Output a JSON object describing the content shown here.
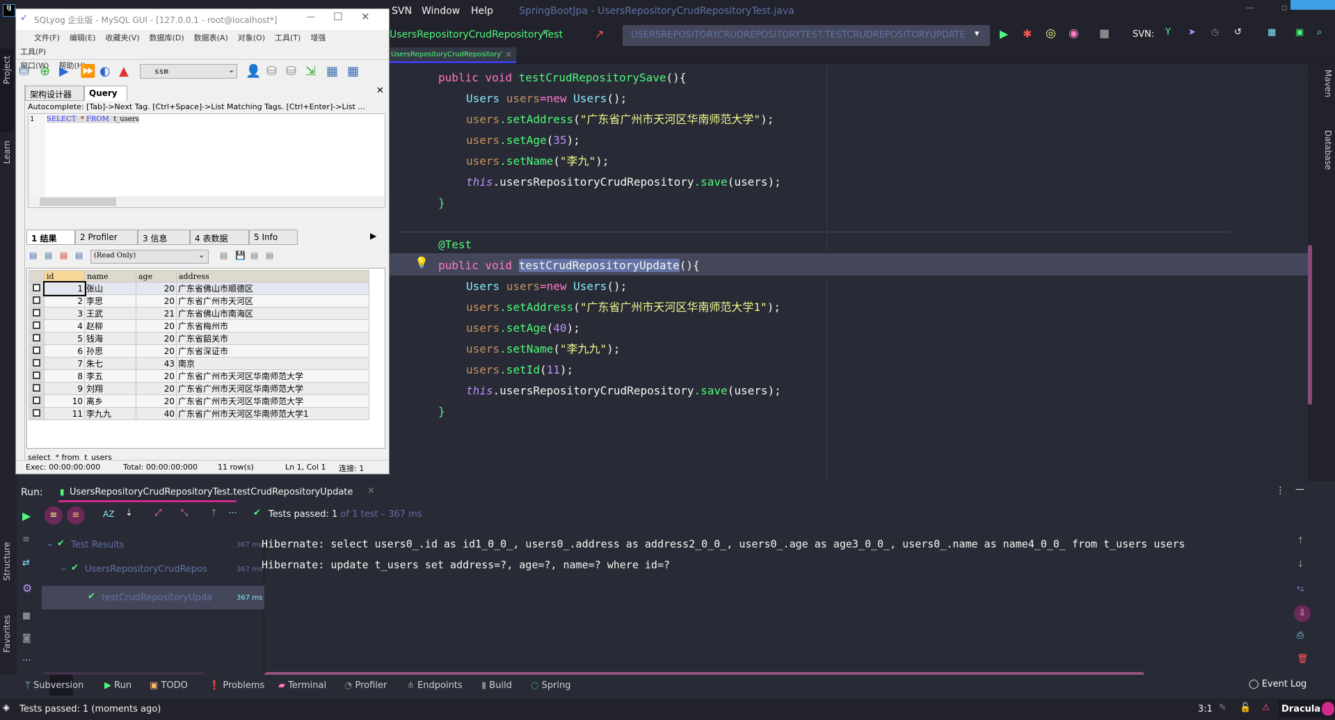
{
  "ide": {
    "menu": [
      "SVN",
      "Window",
      "Help"
    ],
    "title": "SpringBootJpa - UsersRepositoryCrudRepositoryTest.java",
    "breadcrumb": "UsersRepositoryCrudRepositoryTest",
    "run_config": "USERSREPOSITORYCRUDREPOSITORYTEST.TESTCRUDREPOSITORYUPDATE",
    "svn_label": "SVN:",
    "file_tab": "UsersRepositoryCrudRepositoryTest.java",
    "left_tools": [
      "Project",
      "Learn",
      "Structure",
      "Favorites"
    ],
    "right_tools": [
      "Maven",
      "Database"
    ],
    "accent": "#ff79c6"
  },
  "code": {
    "save_method": {
      "signature": [
        "public void ",
        "testCrudRepositorySave",
        "(){"
      ],
      "lines": [
        [
          "Users ",
          "users",
          "=new ",
          "Users",
          "();"
        ],
        [
          "users",
          ".setAddress",
          "(",
          "\"广东省广州市天河区华南师范大学\"",
          ");"
        ],
        [
          "users",
          ".setAge",
          "(",
          "35",
          ");"
        ],
        [
          "users",
          ".setName",
          "(",
          "\"李九\"",
          ");"
        ],
        [
          "this",
          ".usersRepositoryCrudRepository",
          ".save",
          "(users);"
        ]
      ],
      "close": "}"
    },
    "annotation": "@Test",
    "update_method": {
      "signature": [
        "public void ",
        "testCrudRepositoryUpdate",
        "(){"
      ],
      "lines": [
        [
          "Users ",
          "users",
          "=new ",
          "Users",
          "();"
        ],
        [
          "users",
          ".setAddress",
          "(",
          "\"广东省广州市天河区华南师范大学1\"",
          ");"
        ],
        [
          "users",
          ".setAge",
          "(",
          "40",
          ");"
        ],
        [
          "users",
          ".setName",
          "(",
          "\"李九九\"",
          ");"
        ],
        [
          "users",
          ".setId",
          "(",
          "11",
          ");"
        ],
        [
          "this",
          ".usersRepositoryCrudRepository",
          ".save",
          "(users);"
        ]
      ],
      "close": "}"
    }
  },
  "sqlyog": {
    "title": "SQLyog 企业版 - MySQL GUI - [127.0.0.1 - root@localhost*]",
    "menu": [
      "文件(F)",
      "编辑(E)",
      "收藏夹(V)",
      "数据库(D)",
      "数据表(A)",
      "对象(O)",
      "工具(T)",
      "增强工具(P)",
      "窗口(W)",
      "帮助(H)"
    ],
    "database": "ssm",
    "tabs": [
      "架构设计器",
      "Query"
    ],
    "autocomplete_hint": "Autocomplete: [Tab]->Next Tag. [Ctrl+Space]->List Matching Tags. [Ctrl+Enter]->List ...",
    "query_line_no": "1",
    "query": [
      "SELECT",
      "*",
      "FROM",
      "t_users"
    ],
    "result_tabs": [
      "1 结果",
      "2 Profiler",
      "3 信息",
      "4 表数据",
      "5 Info"
    ],
    "mode": "(Read Only)",
    "columns": [
      "id",
      "name",
      "age",
      "address"
    ],
    "rows": [
      [
        "1",
        "张山",
        "20",
        "广东省佛山市顺德区"
      ],
      [
        "2",
        "李思",
        "20",
        "广东省广州市天河区"
      ],
      [
        "3",
        "王武",
        "21",
        "广东省佛山市南海区"
      ],
      [
        "4",
        "赵柳",
        "20",
        "广东省梅州市"
      ],
      [
        "5",
        "钱海",
        "20",
        "广东省韶关市"
      ],
      [
        "6",
        "孙思",
        "20",
        "广东省深证市"
      ],
      [
        "7",
        "朱七",
        "43",
        "南京"
      ],
      [
        "8",
        "李五",
        "20",
        "广东省广州市天河区华南师范大学"
      ],
      [
        "9",
        "刘翔",
        "20",
        "广东省广州市天河区华南师范大学"
      ],
      [
        "10",
        "离乡",
        "20",
        "广东省广州市天河区华南师范大学"
      ],
      [
        "11",
        "李九九",
        "40",
        "广东省广州市天河区华南师范大学1"
      ]
    ],
    "footer_sql": "select  * from  t_users",
    "status": [
      "Exec: 00:00:00:000",
      "Total: 00:00:00:000",
      "11 row(s)",
      "Ln 1, Col 1",
      "连接: 1"
    ]
  },
  "run": {
    "label": "Run:",
    "tab": "UsersRepositoryCrudRepositoryTest.testCrudRepositoryUpdate",
    "passed_label": "Tests passed: 1",
    "passed_detail": " of 1 test – 367 ms",
    "tree": [
      {
        "label": "Test Results",
        "time": "367 ms"
      },
      {
        "label": "UsersRepositoryCrudRepos",
        "time": "367 ms"
      },
      {
        "label": "testCrudRepositoryUpda",
        "time": "367 ms"
      }
    ],
    "console": [
      "Hibernate: select users0_.id as id1_0_0_, users0_.address as address2_0_0_, users0_.age as age3_0_0_, users0_.name as name4_0_0_ from t_users users",
      "Hibernate: update t_users set address=?, age=?, name=? where id=?"
    ]
  },
  "bottom_tools": [
    "Subversion",
    "Run",
    "TODO",
    "Problems",
    "Terminal",
    "Profiler",
    "Endpoints",
    "Build",
    "Spring"
  ],
  "event_log": "Event Log",
  "status": {
    "message": "Tests passed: 1 (moments ago)",
    "position": "3:1",
    "theme": "Dracula"
  }
}
